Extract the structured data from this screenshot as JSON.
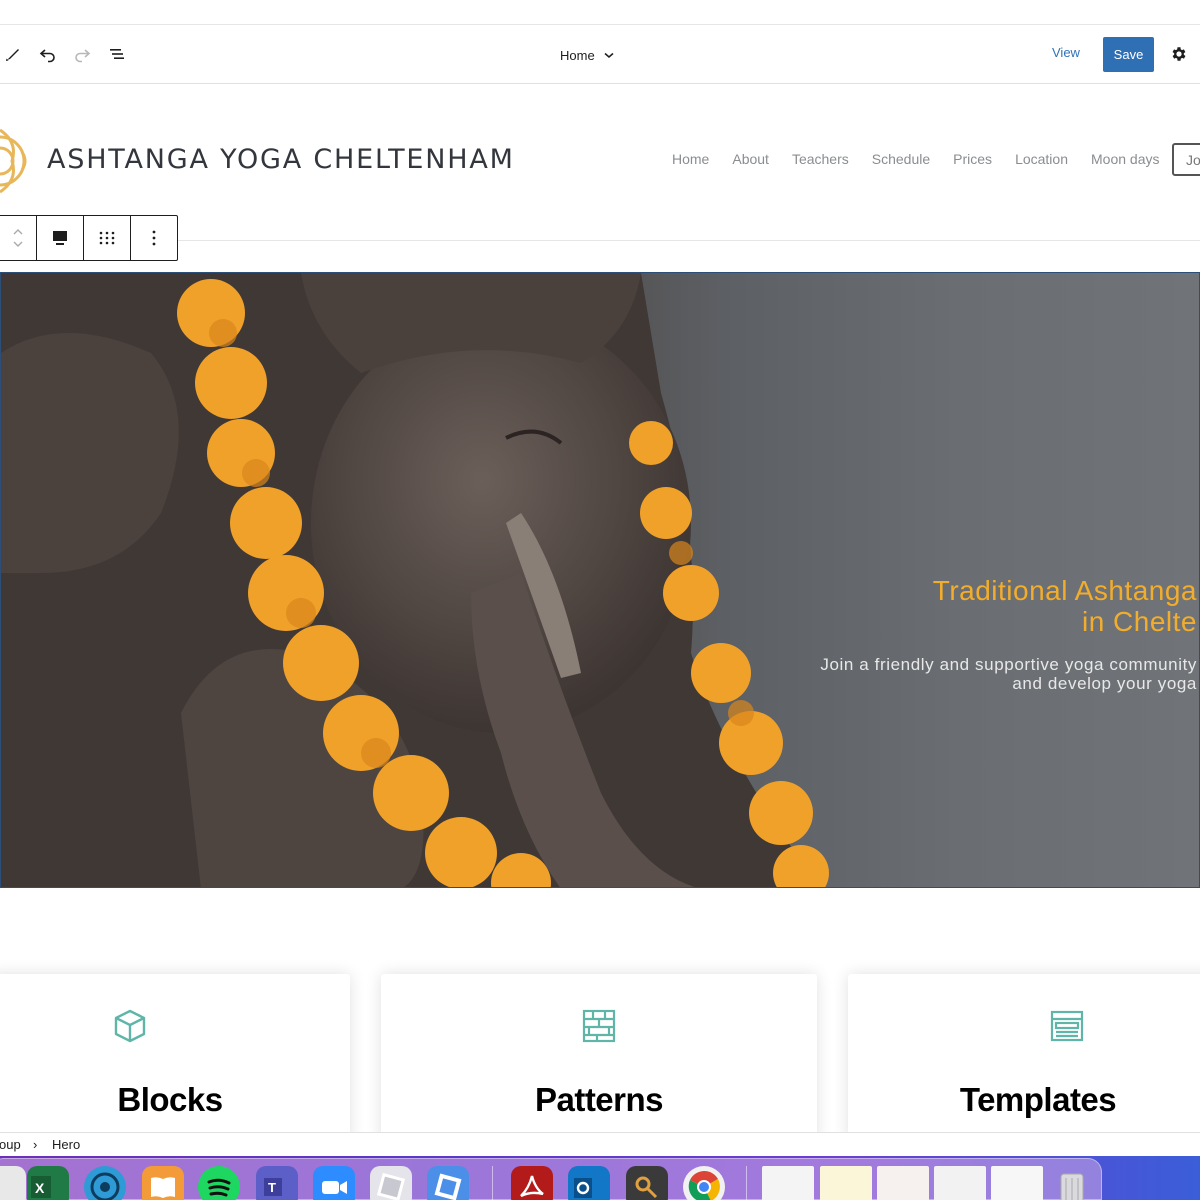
{
  "editor_toolbar": {
    "document_title": "Home",
    "view_label": "View",
    "save_label": "Save"
  },
  "site": {
    "title": "ASHTANGA YOGA CHELTENHAM",
    "nav": [
      "Home",
      "About",
      "Teachers",
      "Schedule",
      "Prices",
      "Location",
      "Moon days"
    ],
    "nav_cta": "Jo"
  },
  "hero": {
    "heading_line1": "Traditional Ashtanga",
    "heading_line2": "in Chelte",
    "sub_line1": "Join a friendly and supportive yoga community",
    "sub_line2": "and develop your yoga"
  },
  "cards": [
    {
      "title": "Blocks",
      "icon": "cube-icon"
    },
    {
      "title": "Patterns",
      "icon": "brick-pattern-icon"
    },
    {
      "title": "Templates",
      "icon": "layout-template-icon"
    }
  ],
  "breadcrumb": {
    "items": [
      "oup",
      "Hero"
    ]
  },
  "colors": {
    "accent": "#2f6fb4",
    "hero_heading": "#f2ad2c",
    "card_icon": "#5fb6a8"
  }
}
